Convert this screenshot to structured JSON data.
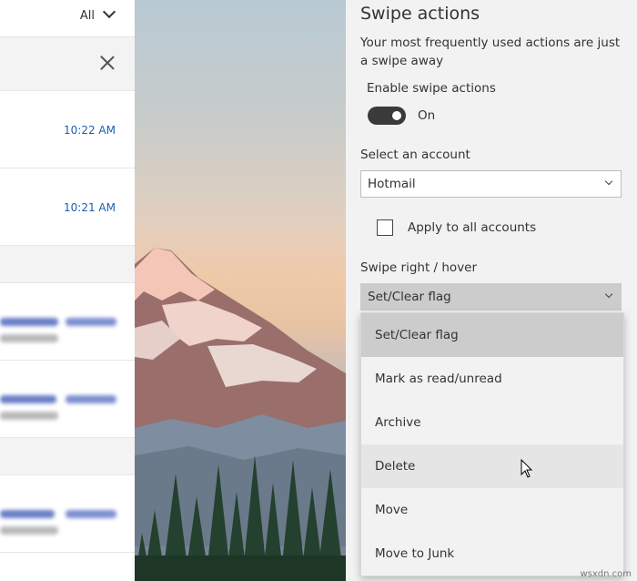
{
  "mail_list": {
    "filter_label": "All",
    "rows": [
      {
        "time": "10:22 AM"
      },
      {
        "time": "10:21 AM"
      }
    ]
  },
  "settings": {
    "title": "Swipe actions",
    "description": "Your most frequently used actions are just a swipe away",
    "enable_label": "Enable swipe actions",
    "toggle_state": "On",
    "account_label": "Select an account",
    "account_value": "Hotmail",
    "apply_all_label": "Apply to all accounts",
    "swipe_right_label": "Swipe right / hover",
    "swipe_right_value": "Set/Clear flag",
    "options": [
      "Set/Clear flag",
      "Mark as read/unread",
      "Archive",
      "Delete",
      "Move",
      "Move to Junk"
    ]
  },
  "watermark": "wsxdn.com"
}
